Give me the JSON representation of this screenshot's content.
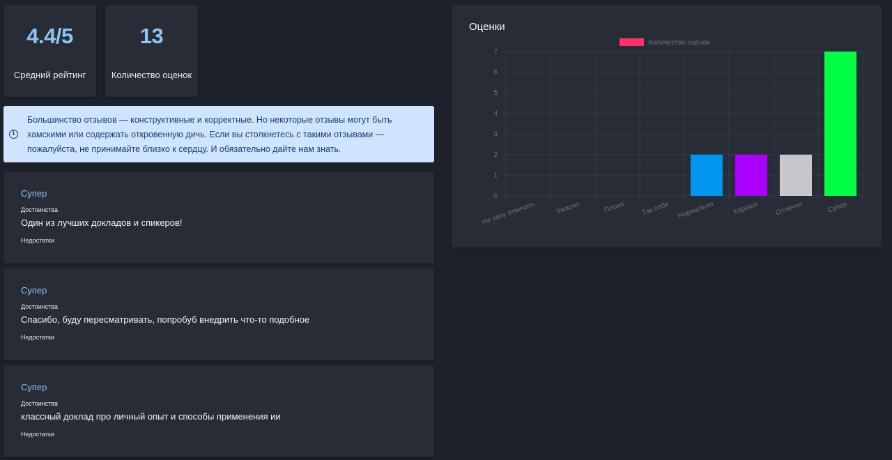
{
  "stats": [
    {
      "value": "4.4/5",
      "label": "Средний рейтинг"
    },
    {
      "value": "13",
      "label": "Количество оценок"
    }
  ],
  "alert": {
    "icon": "info-icon",
    "text": "Большинство отзывов — конструктивные и корректные. Но некоторые отзывы могут быть хамскими или содержать откровенную дичь. Если вы столкнетесь с такими отзывами — пожалуйста, не принимайте близко к сердцу. И обязательно дайте нам знать."
  },
  "reviews": [
    {
      "rating": "Супер",
      "pros_label": "Достоинства",
      "pros": "Один из лучших докладов и спикеров!",
      "cons_label": "Недостатки"
    },
    {
      "rating": "Супер",
      "pros_label": "Достоинства",
      "pros": "Спасибо, буду пересматривать, попробуб внедрить что-то подобное",
      "cons_label": "Недостатки"
    },
    {
      "rating": "Супер",
      "pros_label": "Достоинства",
      "pros": "классный доклад про личный опыт и способы применения ии",
      "cons_label": "Недостатки"
    }
  ],
  "chart_panel": {
    "title": "Оценки"
  },
  "chart_data": {
    "type": "bar",
    "title": "Оценки",
    "categories": [
      "Не хочу отвечать",
      "Ужасно",
      "Плохо",
      "Так себе",
      "Нормально",
      "Хорошо",
      "Отлично",
      "Супер"
    ],
    "values": [
      0,
      0,
      0,
      0,
      2,
      2,
      2,
      7
    ],
    "bar_colors": [
      "#ff3366",
      "#ff3366",
      "#ff3366",
      "#ff3366",
      "#0095ee",
      "#aa00ff",
      "#c8c8cc",
      "#00ff44"
    ],
    "series": [
      {
        "name": "Количество оценок",
        "values": [
          0,
          0,
          0,
          0,
          2,
          2,
          2,
          7
        ]
      }
    ],
    "legend": {
      "label": "Количество оценок",
      "color": "#ff3366",
      "position": "top"
    },
    "ylim": [
      0,
      7
    ],
    "yticks": [
      0,
      1,
      2,
      3,
      4,
      5,
      6,
      7
    ],
    "grid": true
  }
}
